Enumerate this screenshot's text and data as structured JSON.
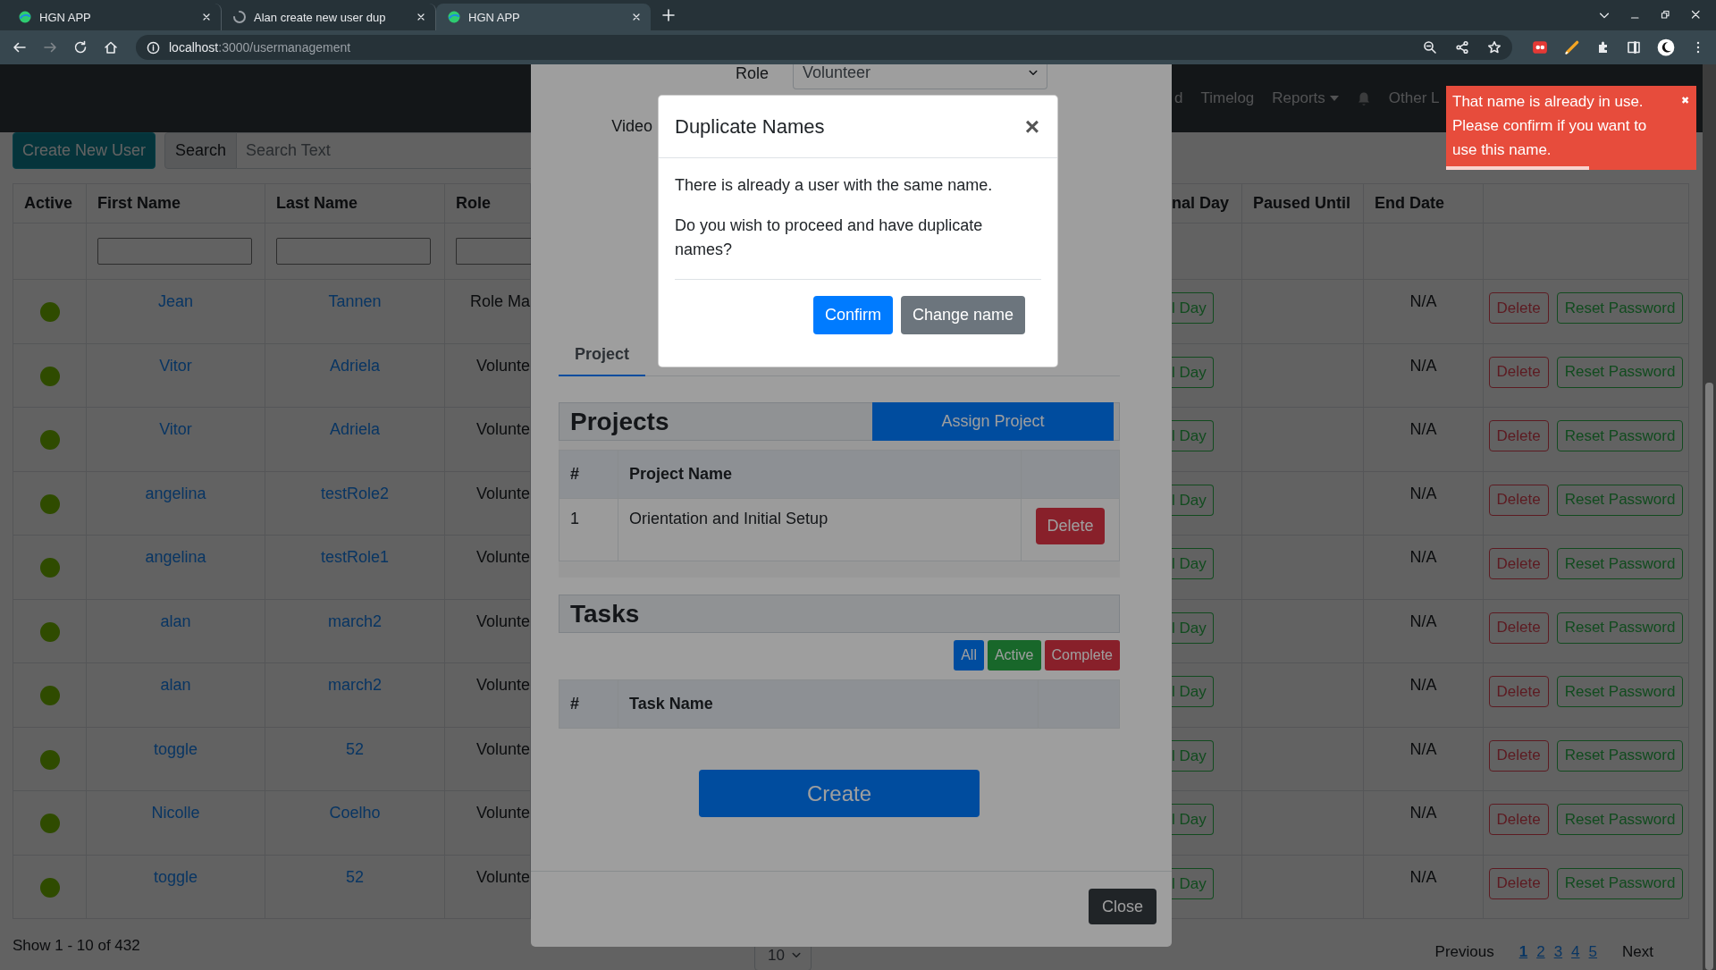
{
  "browser": {
    "tabs": [
      {
        "title": "HGN APP",
        "kind": "app",
        "selected": false
      },
      {
        "title": "Alan create new user dup",
        "kind": "loading",
        "selected": false
      },
      {
        "title": "HGN APP",
        "kind": "app",
        "selected": true
      }
    ],
    "address": {
      "host": "localhost",
      "path": ":3000/usermanagement"
    }
  },
  "navbar": {
    "items": [
      {
        "kind": "link",
        "label": "d"
      },
      {
        "kind": "link",
        "label": "Timelog"
      },
      {
        "kind": "dropdown",
        "label": "Reports"
      },
      {
        "kind": "bell"
      },
      {
        "kind": "link",
        "label": "Other L"
      }
    ]
  },
  "toolbar": {
    "create_button": "Create New User",
    "search_label": "Search",
    "search_placeholder": "Search Text"
  },
  "table": {
    "columns": [
      "Active",
      "First Name",
      "Last Name",
      "Role",
      "nal Day",
      "Paused Until",
      "End Date"
    ],
    "rows": [
      {
        "active": true,
        "first_name": "Jean",
        "last_name": "Tannen",
        "role": "Role Ma",
        "final_day": "l Day",
        "end_date": "N/A",
        "actions": [
          "Delete",
          "Reset Password"
        ]
      },
      {
        "active": true,
        "first_name": "Vitor",
        "last_name": "Adriela",
        "role": "Volunte",
        "final_day": "l Day",
        "end_date": "N/A",
        "actions": [
          "Delete",
          "Reset Password"
        ]
      },
      {
        "active": true,
        "first_name": "Vitor",
        "last_name": "Adriela",
        "role": "Volunte",
        "final_day": "l Day",
        "end_date": "N/A",
        "actions": [
          "Delete",
          "Reset Password"
        ]
      },
      {
        "active": true,
        "first_name": "angelina",
        "last_name": "testRole2",
        "role": "Volunte",
        "final_day": "l Day",
        "end_date": "N/A",
        "actions": [
          "Delete",
          "Reset Password"
        ]
      },
      {
        "active": true,
        "first_name": "angelina",
        "last_name": "testRole1",
        "role": "Volunte",
        "final_day": "l Day",
        "end_date": "N/A",
        "actions": [
          "Delete",
          "Reset Password"
        ]
      },
      {
        "active": true,
        "first_name": "alan",
        "last_name": "march2",
        "role": "Volunte",
        "final_day": "l Day",
        "end_date": "N/A",
        "actions": [
          "Delete",
          "Reset Password"
        ]
      },
      {
        "active": true,
        "first_name": "alan",
        "last_name": "march2",
        "role": "Volunte",
        "final_day": "l Day",
        "end_date": "N/A",
        "actions": [
          "Delete",
          "Reset Password"
        ]
      },
      {
        "active": true,
        "first_name": "toggle",
        "last_name": "52",
        "role": "Volunte",
        "final_day": "l Day",
        "end_date": "N/A",
        "actions": [
          "Delete",
          "Reset Password"
        ]
      },
      {
        "active": true,
        "first_name": "Nicolle",
        "last_name": "Coelho",
        "role": "Volunte",
        "final_day": "l Day",
        "end_date": "N/A",
        "actions": [
          "Delete",
          "Reset Password"
        ]
      },
      {
        "active": true,
        "first_name": "toggle",
        "last_name": "52",
        "role": "Volunte",
        "final_day": "l Day",
        "end_date": "N/A",
        "actions": [
          "Delete",
          "Reset Password"
        ]
      }
    ]
  },
  "pagination": {
    "summary": "Show 1 - 10 of 432",
    "page_size": "10",
    "previous": "Previous",
    "pages": [
      {
        "label": "1",
        "selected": true
      },
      {
        "label": "2",
        "selected": false
      },
      {
        "label": "3",
        "selected": false
      },
      {
        "label": "4",
        "selected": false
      },
      {
        "label": "5",
        "selected": false
      }
    ],
    "next": "Next"
  },
  "user_modal": {
    "role_label": "Role",
    "role_value": "Volunteer",
    "video_label": "Video",
    "tabs": [
      {
        "label": "Project",
        "selected": true
      }
    ],
    "projects": {
      "title": "Projects",
      "assign_button": "Assign Project",
      "columns": [
        "#",
        "Project Name"
      ],
      "rows": [
        {
          "number": "1",
          "name": "Orientation and Initial Setup",
          "action": "Delete"
        }
      ]
    },
    "tasks": {
      "title": "Tasks",
      "filters": [
        {
          "label": "All",
          "kind": "primary"
        },
        {
          "label": "Active",
          "kind": "success"
        },
        {
          "label": "Complete",
          "kind": "danger"
        }
      ],
      "columns": [
        "#",
        "Task Name"
      ]
    },
    "create_button": "Create",
    "close_button": "Close"
  },
  "dialog": {
    "title": "Duplicate Names",
    "close": "×",
    "paragraphs": [
      "There is already a user with the same name.",
      "Do you wish to proceed and have duplicate names?"
    ],
    "buttons": [
      {
        "label": "Confirm",
        "kind": "primary"
      },
      {
        "label": "Change name",
        "kind": "secondary"
      }
    ]
  },
  "toast": {
    "message": "That name is already in use. Please confirm if you want to use this name.",
    "close": "✖",
    "level": 0.57
  }
}
